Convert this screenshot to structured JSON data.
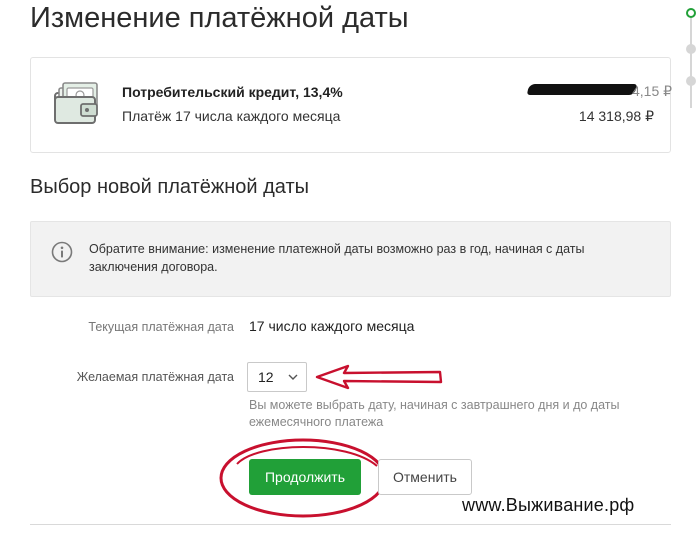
{
  "page": {
    "title": "Изменение платёжной даты"
  },
  "loan": {
    "name": "Потребительский кредит, 13,4%",
    "schedule": "Платёж 17 числа каждого месяца",
    "balance_visible_tail": "4,15 ₽",
    "payment_amount": "14 318,98 ₽",
    "icon": "wallet-icon"
  },
  "section": {
    "title": "Выбор новой платёжной даты"
  },
  "notice": {
    "icon": "info-icon",
    "text": "Обратите внимание: изменение платежной даты возможно раз в год, начиная с даты заключения договора."
  },
  "form": {
    "current_label": "Текущая платёжная дата",
    "current_value": "17 число каждого месяца",
    "desired_label": "Желаемая платёжная дата",
    "desired_value": "12",
    "hint": "Вы можете выбрать дату, начиная с завтрашнего дня и до даты ежемесячного платежа"
  },
  "actions": {
    "continue_label": "Продолжить",
    "cancel_label": "Отменить"
  },
  "watermark": "www.Выживание.рф",
  "colors": {
    "accent_green": "#21a038",
    "annotation_red": "#c8102e",
    "notice_bg": "#f2f2f2"
  }
}
